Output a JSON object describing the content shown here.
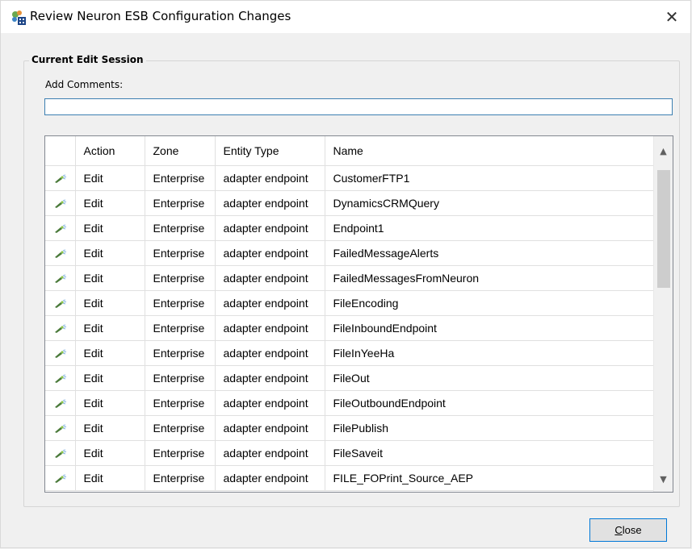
{
  "window": {
    "title": "Review Neuron ESB Configuration Changes",
    "close_glyph": "✕"
  },
  "group": {
    "legend": "Current Edit Session",
    "comments_label": "Add Comments:",
    "comments_value": ""
  },
  "grid": {
    "columns": [
      "",
      "Action",
      "Zone",
      "Entity Type",
      "Name"
    ],
    "rows": [
      {
        "icon": "edit-pencil-icon",
        "action": "Edit",
        "zone": "Enterprise",
        "entity_type": "adapter endpoint",
        "name": "CustomerFTP1"
      },
      {
        "icon": "edit-pencil-icon",
        "action": "Edit",
        "zone": "Enterprise",
        "entity_type": "adapter endpoint",
        "name": "DynamicsCRMQuery"
      },
      {
        "icon": "edit-pencil-icon",
        "action": "Edit",
        "zone": "Enterprise",
        "entity_type": "adapter endpoint",
        "name": "Endpoint1"
      },
      {
        "icon": "edit-pencil-icon",
        "action": "Edit",
        "zone": "Enterprise",
        "entity_type": "adapter endpoint",
        "name": "FailedMessageAlerts"
      },
      {
        "icon": "edit-pencil-icon",
        "action": "Edit",
        "zone": "Enterprise",
        "entity_type": "adapter endpoint",
        "name": "FailedMessagesFromNeuron"
      },
      {
        "icon": "edit-pencil-icon",
        "action": "Edit",
        "zone": "Enterprise",
        "entity_type": "adapter endpoint",
        "name": "FileEncoding"
      },
      {
        "icon": "edit-pencil-icon",
        "action": "Edit",
        "zone": "Enterprise",
        "entity_type": "adapter endpoint",
        "name": "FileInboundEndpoint"
      },
      {
        "icon": "edit-pencil-icon",
        "action": "Edit",
        "zone": "Enterprise",
        "entity_type": "adapter endpoint",
        "name": "FileInYeeHa"
      },
      {
        "icon": "edit-pencil-icon",
        "action": "Edit",
        "zone": "Enterprise",
        "entity_type": "adapter endpoint",
        "name": "FileOut"
      },
      {
        "icon": "edit-pencil-icon",
        "action": "Edit",
        "zone": "Enterprise",
        "entity_type": "adapter endpoint",
        "name": "FileOutboundEndpoint"
      },
      {
        "icon": "edit-pencil-icon",
        "action": "Edit",
        "zone": "Enterprise",
        "entity_type": "adapter endpoint",
        "name": "FilePublish"
      },
      {
        "icon": "edit-pencil-icon",
        "action": "Edit",
        "zone": "Enterprise",
        "entity_type": "adapter endpoint",
        "name": "FileSaveit"
      },
      {
        "icon": "edit-pencil-icon",
        "action": "Edit",
        "zone": "Enterprise",
        "entity_type": "adapter endpoint",
        "name": "FILE_FOPrint_Source_AEP"
      }
    ]
  },
  "buttons": {
    "close_mnemonic": "C",
    "close_rest": "lose"
  },
  "colors": {
    "accent": "#0078d7",
    "input_border": "#3c7fb1"
  }
}
